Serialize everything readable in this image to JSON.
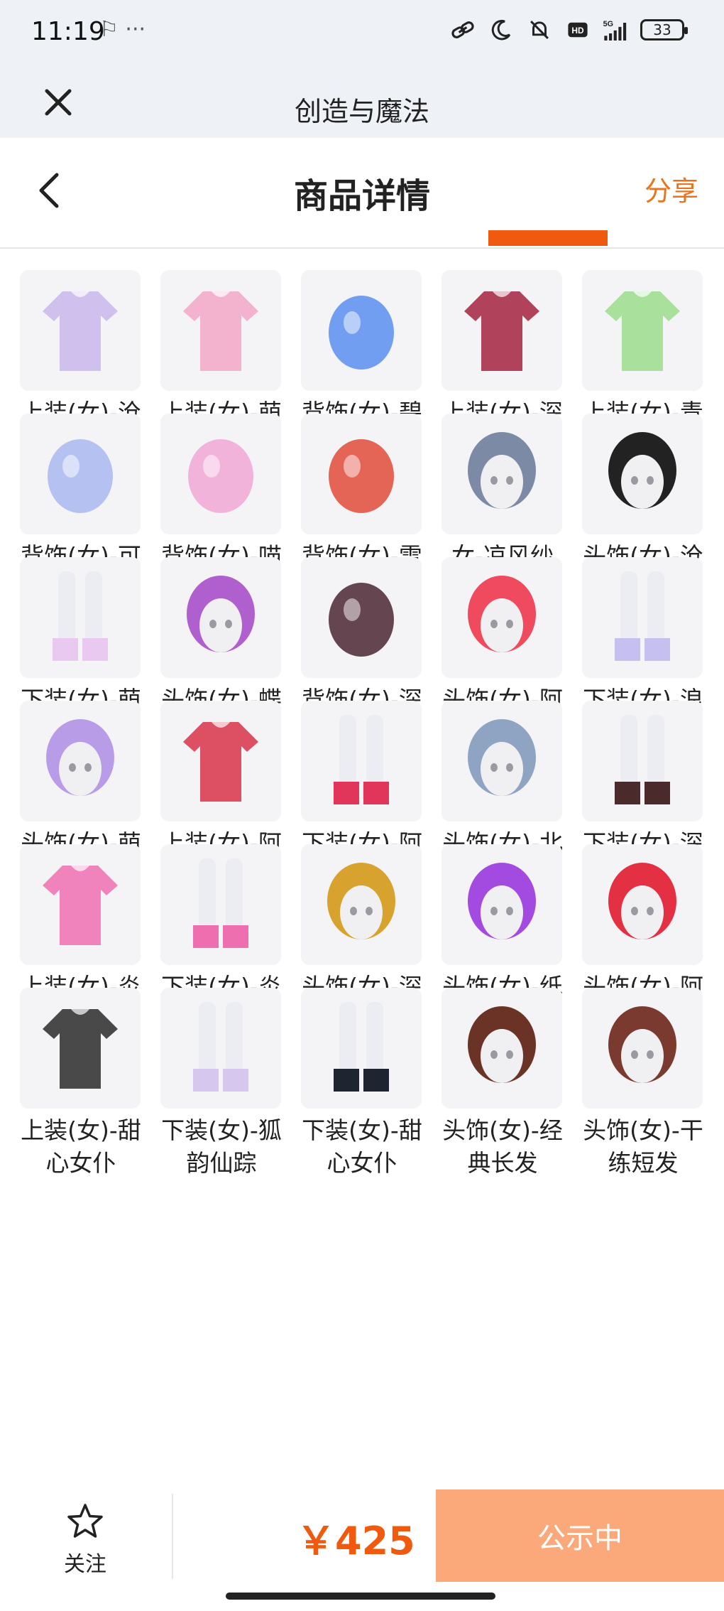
{
  "status_bar": {
    "time": "11:19",
    "extra": "⚐ ···",
    "battery": "33",
    "network": "5G"
  },
  "app_bar": {
    "title": "创造与魔法"
  },
  "header": {
    "title": "商品详情",
    "share": "分享"
  },
  "items": [
    {
      "label": "上装(女)-沧海泣珠",
      "icon": "top-outfit",
      "color": "#c9b6ec"
    },
    {
      "label": "上装(女)-萌喵女仆",
      "icon": "top-outfit",
      "color": "#f2a7c8"
    },
    {
      "label": "背饰(女)-碧游鱼灵",
      "icon": "back-accessory",
      "color": "#5a8ef0"
    },
    {
      "label": "上装(女)-深渊盔甲",
      "icon": "top-outfit",
      "color": "#a3233f"
    },
    {
      "label": "上装(女)-青柠密语",
      "icon": "top-outfit",
      "color": "#9bdc8c"
    },
    {
      "label": "背饰(女)-可爱鲨鱼",
      "icon": "back-accessory",
      "color": "#a9b8f0"
    },
    {
      "label": "背饰(女)-喵喵尾",
      "icon": "back-accessory",
      "color": "#f1a7d6"
    },
    {
      "label": "背饰(女)-雪人背包",
      "icon": "back-accessory",
      "color": "#e04a3a"
    },
    {
      "label": "女-凉风纱笠",
      "icon": "head-accessory",
      "color": "#7c8aa6"
    },
    {
      "label": "头饰(女)-沧海泣珠",
      "icon": "head-accessory",
      "color": "#222222"
    },
    {
      "label": "下装(女)-萌喵女仆",
      "icon": "bottom-outfit",
      "color": "#e9c9ef"
    },
    {
      "label": "头饰(女)-蝶惑",
      "icon": "head-accessory",
      "color": "#b05fcf"
    },
    {
      "label": "背饰(女)-深渊盔甲",
      "icon": "back-accessory",
      "color": "#4a2632"
    },
    {
      "label": "头饰(女)-阿狸",
      "icon": "head-accessory",
      "color": "#ef4a5e"
    },
    {
      "label": "下装(女)-浪漫花童",
      "icon": "bottom-outfit",
      "color": "#c5c0ef"
    },
    {
      "label": "头饰(女)-萌喵女仆",
      "icon": "head-accessory",
      "color": "#b99ce8"
    },
    {
      "label": "上装(女)-阿狸萌趣",
      "icon": "top-outfit",
      "color": "#d8324a"
    },
    {
      "label": "下装(女)-阿狸萌趣",
      "icon": "bottom-outfit",
      "color": "#e1365a"
    },
    {
      "label": "头饰(女)-北境晴冬",
      "icon": "head-accessory",
      "color": "#8fa4c2"
    },
    {
      "label": "下装(女)-深渊盔甲",
      "icon": "bottom-outfit",
      "color": "#4a2a2a"
    },
    {
      "label": "上装(女)-炎夏",
      "icon": "top-outfit",
      "color": "#ee6fb0"
    },
    {
      "label": "下装(女)-炎夏",
      "icon": "bottom-outfit",
      "color": "#ee6fb0"
    },
    {
      "label": "头饰(女)-深渊盔甲",
      "icon": "head-accessory",
      "color": "#d8a22e"
    },
    {
      "label": "头饰(女)-纸袋",
      "icon": "head-accessory",
      "color": "#a34be0"
    },
    {
      "label": "头饰(女)-阿狸萌趣",
      "icon": "head-accessory",
      "color": "#e33042"
    },
    {
      "label": "上装(女)-甜心女仆",
      "icon": "top-outfit",
      "color": "#2a2a2a"
    },
    {
      "label": "下装(女)-狐韵仙踪",
      "icon": "bottom-outfit",
      "color": "#d6c7ee"
    },
    {
      "label": "下装(女)-甜心女仆",
      "icon": "bottom-outfit",
      "color": "#1e2430"
    },
    {
      "label": "头饰(女)-经典长发",
      "icon": "head-accessory",
      "color": "#6b3325"
    },
    {
      "label": "头饰(女)-干练短发",
      "icon": "head-accessory",
      "color": "#7a3a30"
    }
  ],
  "bottom_bar": {
    "follow_label": "关注",
    "price": "￥425",
    "cta_label": "公示中"
  },
  "colors": {
    "accent": "#f05a0e",
    "share": "#e8741e",
    "cta_bg": "#fba97a"
  }
}
